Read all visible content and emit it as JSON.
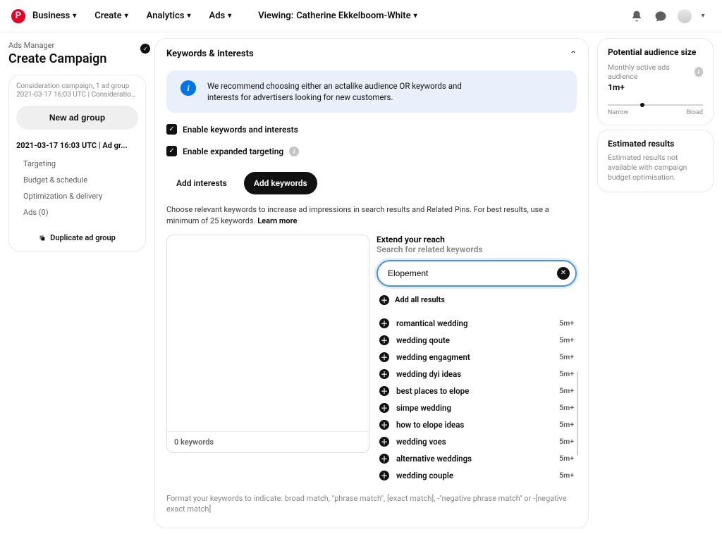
{
  "topnav": {
    "items": [
      "Business",
      "Create",
      "Analytics",
      "Ads"
    ],
    "viewing_prefix": "Viewing: ",
    "viewing_name": "Catherine Ekkelboom-White"
  },
  "left": {
    "ads_manager": "Ads Manager",
    "create_campaign": "Create Campaign",
    "campaign_desc": "Consideration campaign, 1 ad group",
    "campaign_sub": "2021-03-17 16:03 UTC | Consideration...",
    "new_ad_group": "New ad group",
    "adgroup_label": "2021-03-17 16:03 UTC | Ad gr...",
    "links": [
      "Targeting",
      "Budget & schedule",
      "Optimization & delivery",
      "Ads (0)"
    ],
    "duplicate": "Duplicate ad group"
  },
  "center": {
    "section_title": "Keywords & interests",
    "info": "We recommend choosing either an actalike audience OR keywords and interests for advertisers looking for new customers.",
    "checkbox1": "Enable keywords and interests",
    "checkbox2": "Enable expanded targeting",
    "tab1": "Add interests",
    "tab2": "Add keywords",
    "desc": "Choose relevant keywords to increase ad impressions in search results and Related Pins. For best results, use a minimum of 25 keywords. ",
    "learn_more": "Learn more",
    "kw_count": "0 keywords",
    "extend_title": "Extend your reach",
    "extend_sub": "Search for related keywords",
    "search_value": "Elopement",
    "add_all": "Add all results",
    "results": [
      {
        "label": "romantical wedding",
        "metric": "5m+"
      },
      {
        "label": "wedding qoute",
        "metric": "5m+"
      },
      {
        "label": "wedding engagment",
        "metric": "5m+"
      },
      {
        "label": "wedding dyi ideas",
        "metric": "5m+"
      },
      {
        "label": "best places to elope",
        "metric": "5m+"
      },
      {
        "label": "simpe wedding",
        "metric": "5m+"
      },
      {
        "label": "how to elope ideas",
        "metric": "5m+"
      },
      {
        "label": "wedding voes",
        "metric": "5m+"
      },
      {
        "label": "alternative weddings",
        "metric": "5m+"
      },
      {
        "label": "wedding couple",
        "metric": "5m+"
      }
    ],
    "footer": "Format your keywords to indicate: broad match, \"phrase match\", [exact match], -\"negative phrase match\" or -[negative exact match]"
  },
  "right": {
    "card1_title": "Potential audience size",
    "card1_sub": "Monthly active ads audience",
    "card1_value": "1m+",
    "narrow": "Narrow",
    "broad": "Broad",
    "card2_title": "Estimated results",
    "card2_desc": "Estimated results not available with campaign budget optimisation."
  }
}
